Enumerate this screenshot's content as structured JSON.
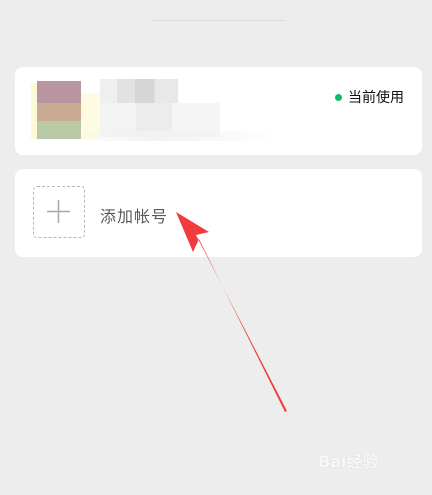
{
  "current_account": {
    "status_label": "当前使用",
    "status_color": "#07c160"
  },
  "add_account": {
    "label": "添加帐号",
    "icon": "plus-icon"
  },
  "annotation": {
    "arrow_color": "#f03c3c"
  },
  "watermark": {
    "text": "Bai经验"
  }
}
